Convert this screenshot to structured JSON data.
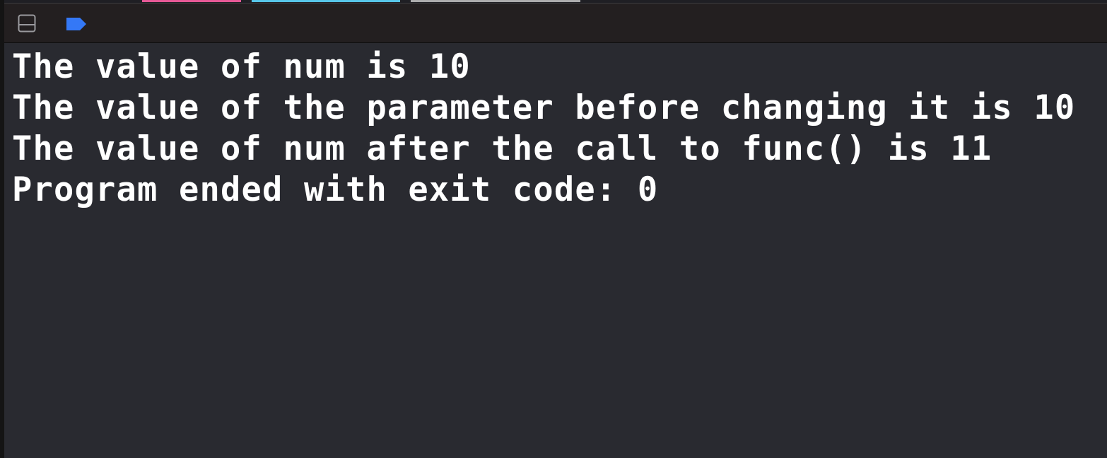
{
  "colors": {
    "console_background": "#292a30",
    "toolbar_background": "#231f20",
    "console_text": "#ffffff",
    "breakpoint_accent": "#3478f6",
    "toggle_icon": "#9a9a9e"
  },
  "toolbar": {
    "toggle_icon": "hide-debug-area-icon",
    "breakpoint_icon": "breakpoint-indicator-icon"
  },
  "console": {
    "lines": [
      "The value of num is 10",
      "The value of the parameter before changing it is 10",
      "The value of num after the call to func() is 11",
      "Program ended with exit code: 0"
    ]
  }
}
